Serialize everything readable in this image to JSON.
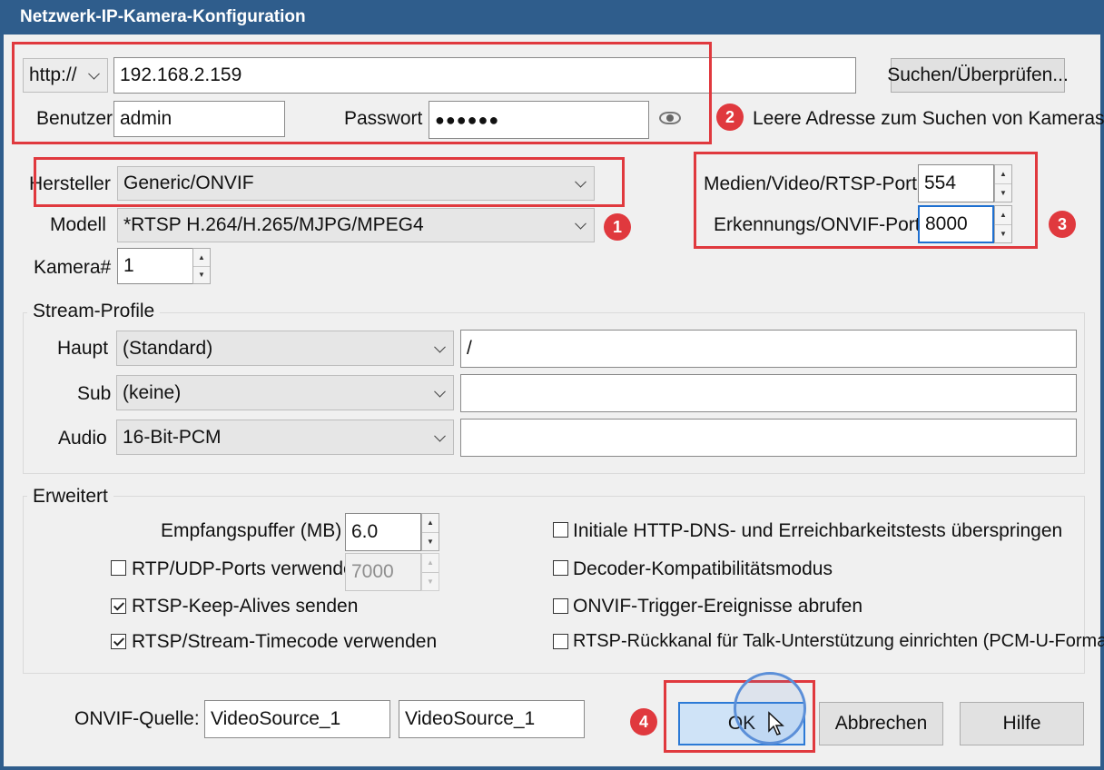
{
  "window": {
    "title": "Netzwerk-IP-Kamera-Konfiguration"
  },
  "connection": {
    "protocol": "http://",
    "address": "192.168.2.159",
    "search_button": "Suchen/Überprüfen...",
    "user_label": "Benutzer",
    "user_value": "admin",
    "password_label": "Passwort",
    "password_value": "●●●●●●",
    "hint": "Leere Adresse zum Suchen von Kameras"
  },
  "device": {
    "manufacturer_label": "Hersteller",
    "manufacturer_value": "Generic/ONVIF",
    "model_label": "Modell",
    "model_value": "*RTSP H.264/H.265/MJPG/MPEG4",
    "camera_label": "Kamera#",
    "camera_value": "1"
  },
  "ports": {
    "rtsp_label": "Medien/Video/RTSP-Port",
    "rtsp_value": "554",
    "onvif_label": "Erkennungs/ONVIF-Port",
    "onvif_value": "8000"
  },
  "stream_profile": {
    "title": "Stream-Profile",
    "rows": [
      {
        "label": "Haupt",
        "select": "(Standard)",
        "path": "/"
      },
      {
        "label": "Sub",
        "select": "(keine)",
        "path": ""
      },
      {
        "label": "Audio",
        "select": "16-Bit-PCM",
        "path": ""
      }
    ]
  },
  "advanced": {
    "title": "Erweitert",
    "buffer_label": "Empfangspuffer (MB)",
    "buffer_value": "6.0",
    "rtp_label": "RTP/UDP-Ports verwenden:",
    "rtp_value": "7000",
    "rtp_checked": false,
    "keepalive_label": "RTSP-Keep-Alives senden",
    "keepalive_checked": true,
    "timecode_label": "RTSP/Stream-Timecode verwenden",
    "timecode_checked": true,
    "skip_dns_label": "Initiale HTTP-DNS- und Erreichbarkeitstests überspringen",
    "skip_dns_checked": false,
    "decoder_label": "Decoder-Kompatibilitätsmodus",
    "decoder_checked": false,
    "onvif_trigger_label": "ONVIF-Trigger-Ereignisse abrufen",
    "onvif_trigger_checked": false,
    "backchannel_label": "RTSP-Rückkanal für Talk-Unterstützung einrichten (PCM-U-Format)",
    "backchannel_checked": false
  },
  "footer": {
    "onvif_source_label": "ONVIF-Quelle:",
    "onvif_source_1": "VideoSource_1",
    "onvif_source_2": "VideoSource_1",
    "ok": "OK",
    "cancel": "Abbrechen",
    "help": "Hilfe"
  },
  "annotations": {
    "badge_1": "1",
    "badge_2": "2",
    "badge_3": "3",
    "badge_4": "4",
    "highlight_color": "#e0393e"
  }
}
